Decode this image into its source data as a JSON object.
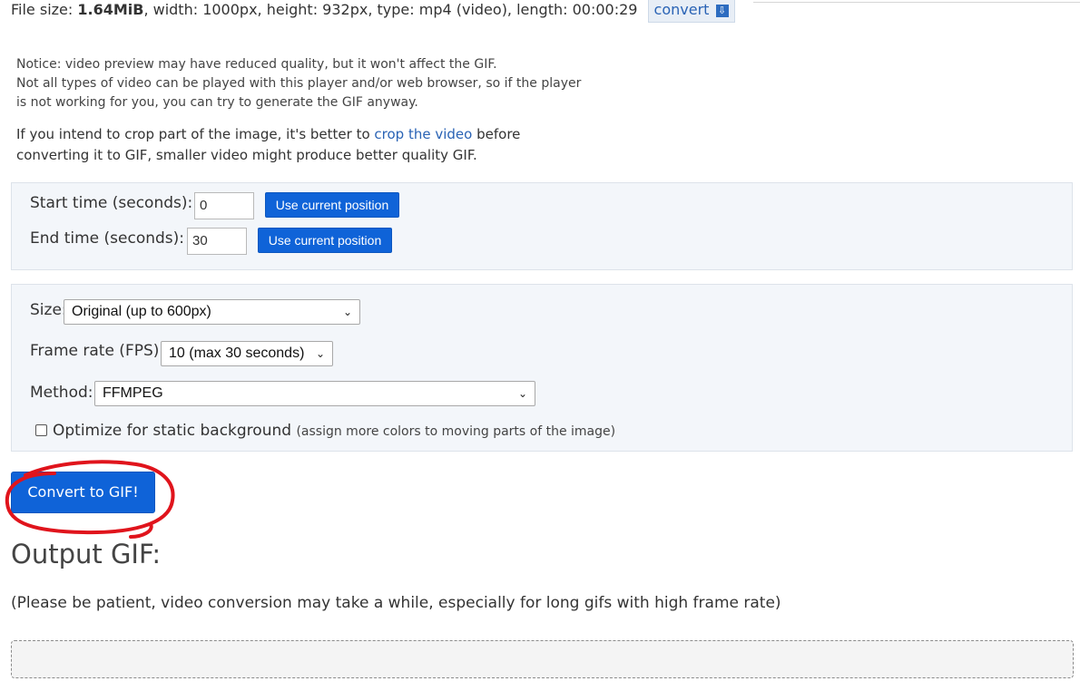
{
  "file_info": {
    "prefix": "File size: ",
    "size": "1.64MiB",
    "rest": ", width: 1000px, height: 932px, type: mp4 (video), length: 00:00:29",
    "convert_link": "convert"
  },
  "notices": {
    "line1": "Notice: video preview may have reduced quality, but it won't affect the GIF.",
    "line2": "Not all types of video can be played with this player and/or web browser, so if the player",
    "line3": "is not working for you, you can try to generate the GIF anyway.",
    "crop_before": "If you intend to crop part of the image, it's better to ",
    "crop_link": "crop the video",
    "crop_after": " before",
    "crop_line2": "converting it to GIF, smaller video might produce better quality GIF."
  },
  "time_panel": {
    "start_label": "Start time (seconds):",
    "start_value": "0",
    "end_label": "End time (seconds):",
    "end_value": "30",
    "use_current_label": "Use current position"
  },
  "options_panel": {
    "size_label": "Size:",
    "size_value": "Original (up to 600px)",
    "fps_label": "Frame rate (FPS):",
    "fps_value": "10 (max 30 seconds)",
    "method_label": "Method:",
    "method_value": "FFMPEG",
    "optimize_label": "Optimize for static background",
    "optimize_note": "(assign more colors to moving parts of the image)",
    "optimize_checked": false
  },
  "convert_button": "Convert to GIF!",
  "output": {
    "heading": "Output GIF:",
    "patience": "(Please be patient, video conversion may take a while, especially for long gifs with high frame rate)"
  },
  "colors": {
    "accent": "#0f63d8",
    "annotation": "#e0141c",
    "panel_bg": "#f3f6fa"
  }
}
